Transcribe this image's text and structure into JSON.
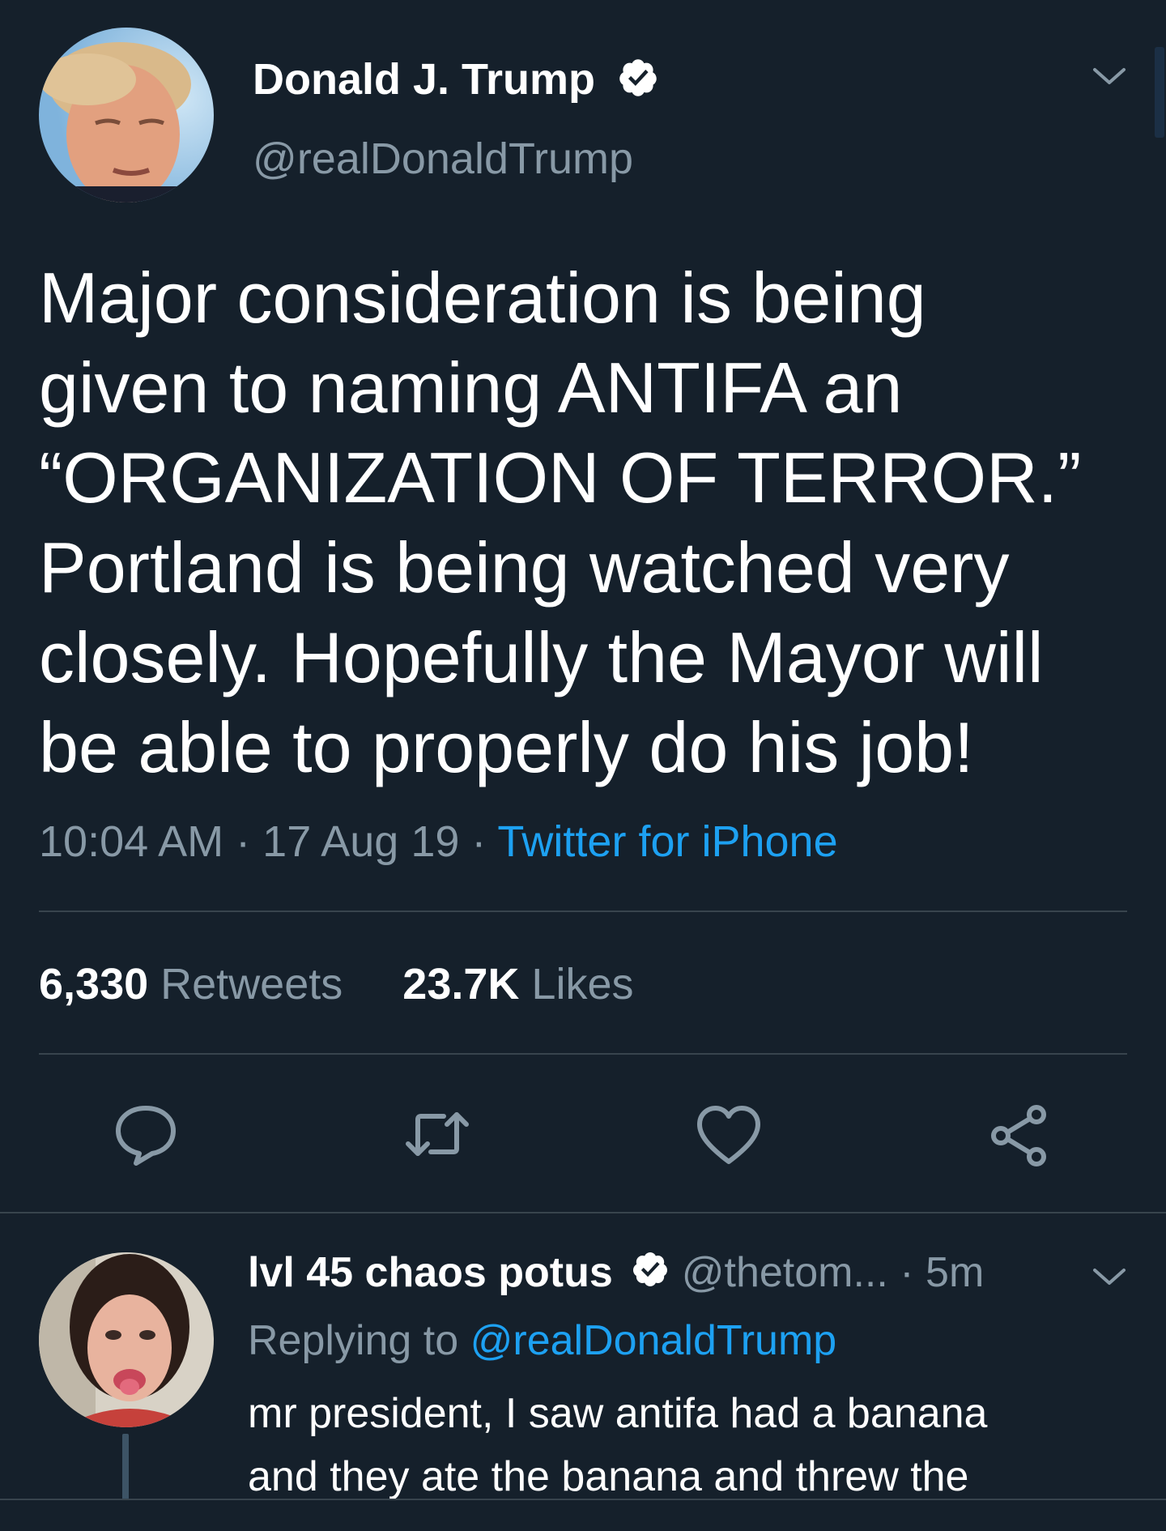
{
  "tweet": {
    "author_name": "Donald J. Trump",
    "author_handle": "@realDonaldTrump",
    "text_lines": [
      "Major consideration is being",
      "given to naming ANTIFA an",
      "“ORGANIZATION OF TERROR.”",
      "Portland is being watched very",
      "closely. Hopefully the Mayor will",
      "be able to properly do his job!"
    ],
    "time": "10:04 AM",
    "sep1": " · ",
    "date": "17 Aug 19",
    "sep2": " · ",
    "source": "Twitter for iPhone",
    "retweets_count": "6,330",
    "retweets_label": "Retweets",
    "likes_count": "23.7K",
    "likes_label": "Likes"
  },
  "actions": {
    "reply_icon": "reply-bubble-icon",
    "retweet_icon": "retweet-icon",
    "like_icon": "heart-icon",
    "share_icon": "share-icon"
  },
  "reply": {
    "author_name": "lvl 45 chaos potus",
    "author_handle": "@thetom...",
    "time": " · 5m",
    "replying_prefix": "Replying to ",
    "replying_to": "@realDonaldTrump",
    "text_lines": [
      "mr president, I saw antifa had a banana",
      "and they ate the banana and threw the"
    ]
  },
  "colors": {
    "background": "#15202b",
    "secondary_text": "#8899a6",
    "link": "#1da1f2",
    "divider": "#38444d"
  }
}
